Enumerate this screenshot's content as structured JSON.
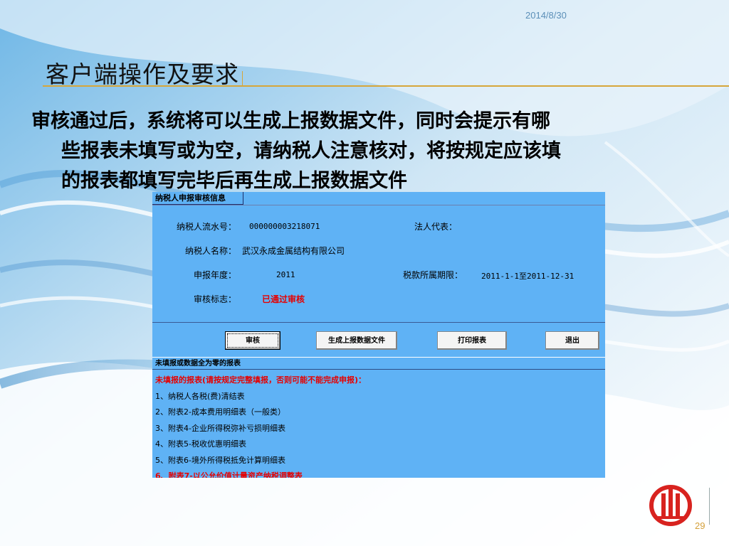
{
  "slide": {
    "date": "2014/8/30",
    "title": "客户端操作及要求",
    "body_line1": "审核通过后，系统将可以生成上报数据文件，同时会提示有哪",
    "body_line2": "些报表未填写或为空，请纳税人注意核对，将按规定应该填",
    "body_line3": "的报表都填写完毕后再生成上报数据文件",
    "page_number": "29"
  },
  "app": {
    "panel_title": "纳税人申报审核信息",
    "fields": {
      "serial_label": "纳税人流水号：",
      "serial_value": "000000003218071",
      "legal_rep_label": "法人代表：",
      "legal_rep_value": "",
      "name_label": "纳税人名称：",
      "name_value": "武汉永成金属结构有限公司",
      "year_label": "申报年度：",
      "year_value": "2011",
      "period_label": "税款所属期限：",
      "period_value": "2011-1-1至2011-12-31",
      "status_label": "审核标志：",
      "status_value": "已通过审核"
    },
    "buttons": {
      "audit": "审核",
      "generate": "生成上报数据文件",
      "print": "打印报表",
      "exit": "退出"
    },
    "list_header": "未填报或数据全为零的报表",
    "list_items": [
      "未填报的报表(请按规定完整填报，否则可能不能完成申报)：",
      "1、纳税人各税(费)清结表",
      "2、附表2-成本费用明细表（一般类）",
      "3、附表4-企业所得税弥补亏损明细表",
      "4、附表5-税收优惠明细表",
      "5、附表6-境外所得税抵免计算明细表",
      "6、附表7-以公允价值计量资产纳税调整表"
    ]
  },
  "colors": {
    "accent_gold": "#d6a63a",
    "app_blue": "#5fb2f5",
    "warning_red": "#e60000"
  }
}
